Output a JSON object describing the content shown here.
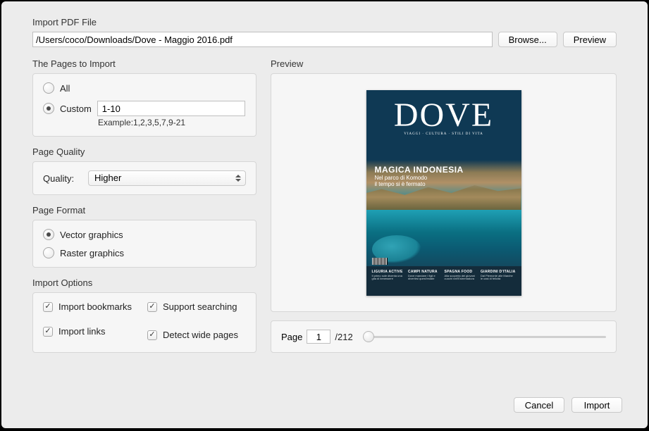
{
  "header": {
    "title": "Import PDF File"
  },
  "filepath": "/Users/coco/Downloads/Dove - Maggio 2016.pdf",
  "buttons": {
    "browse": "Browse...",
    "preview": "Preview",
    "cancel": "Cancel",
    "import": "Import"
  },
  "sections": {
    "pages_to_import": "The Pages to Import",
    "page_quality": "Page Quality",
    "page_format": "Page Format",
    "import_options": "Import Options",
    "preview": "Preview"
  },
  "pages": {
    "all_label": "All",
    "custom_label": "Custom",
    "custom_value": "1-10",
    "example": "Example:1,2,3,5,7,9-21"
  },
  "quality": {
    "label": "Quality:",
    "value": "Higher"
  },
  "format": {
    "vector": "Vector graphics",
    "raster": "Raster graphics"
  },
  "options": {
    "bookmarks": "Import bookmarks",
    "searching": "Support searching",
    "links": "Import links",
    "wide": "Detect wide pages"
  },
  "pager": {
    "page_label": "Page",
    "current": "1",
    "total": "/212"
  },
  "cover": {
    "masthead": "DOVE",
    "headline_main": "MAGICA INDONESIA",
    "headline_sub1": "Nel parco di Komodo",
    "headline_sub2": "il tempo si è fermato",
    "col1_t": "LIGURIA ACTIVE",
    "col1_d": "Il primo sole diventa una gita di benessere",
    "col2_t": "CAMPI NATURA",
    "col2_d": "Dove mandare i figli e divertirsi quest'estate",
    "col3_t": "SPAGNA FOOD",
    "col3_d": "Alla scoperta dei giovani cuochi nell'Estremadura",
    "col4_t": "GIARDINI D'ITALIA",
    "col4_d": "Dal Piemonte alle Marche le oasi di felicità"
  }
}
